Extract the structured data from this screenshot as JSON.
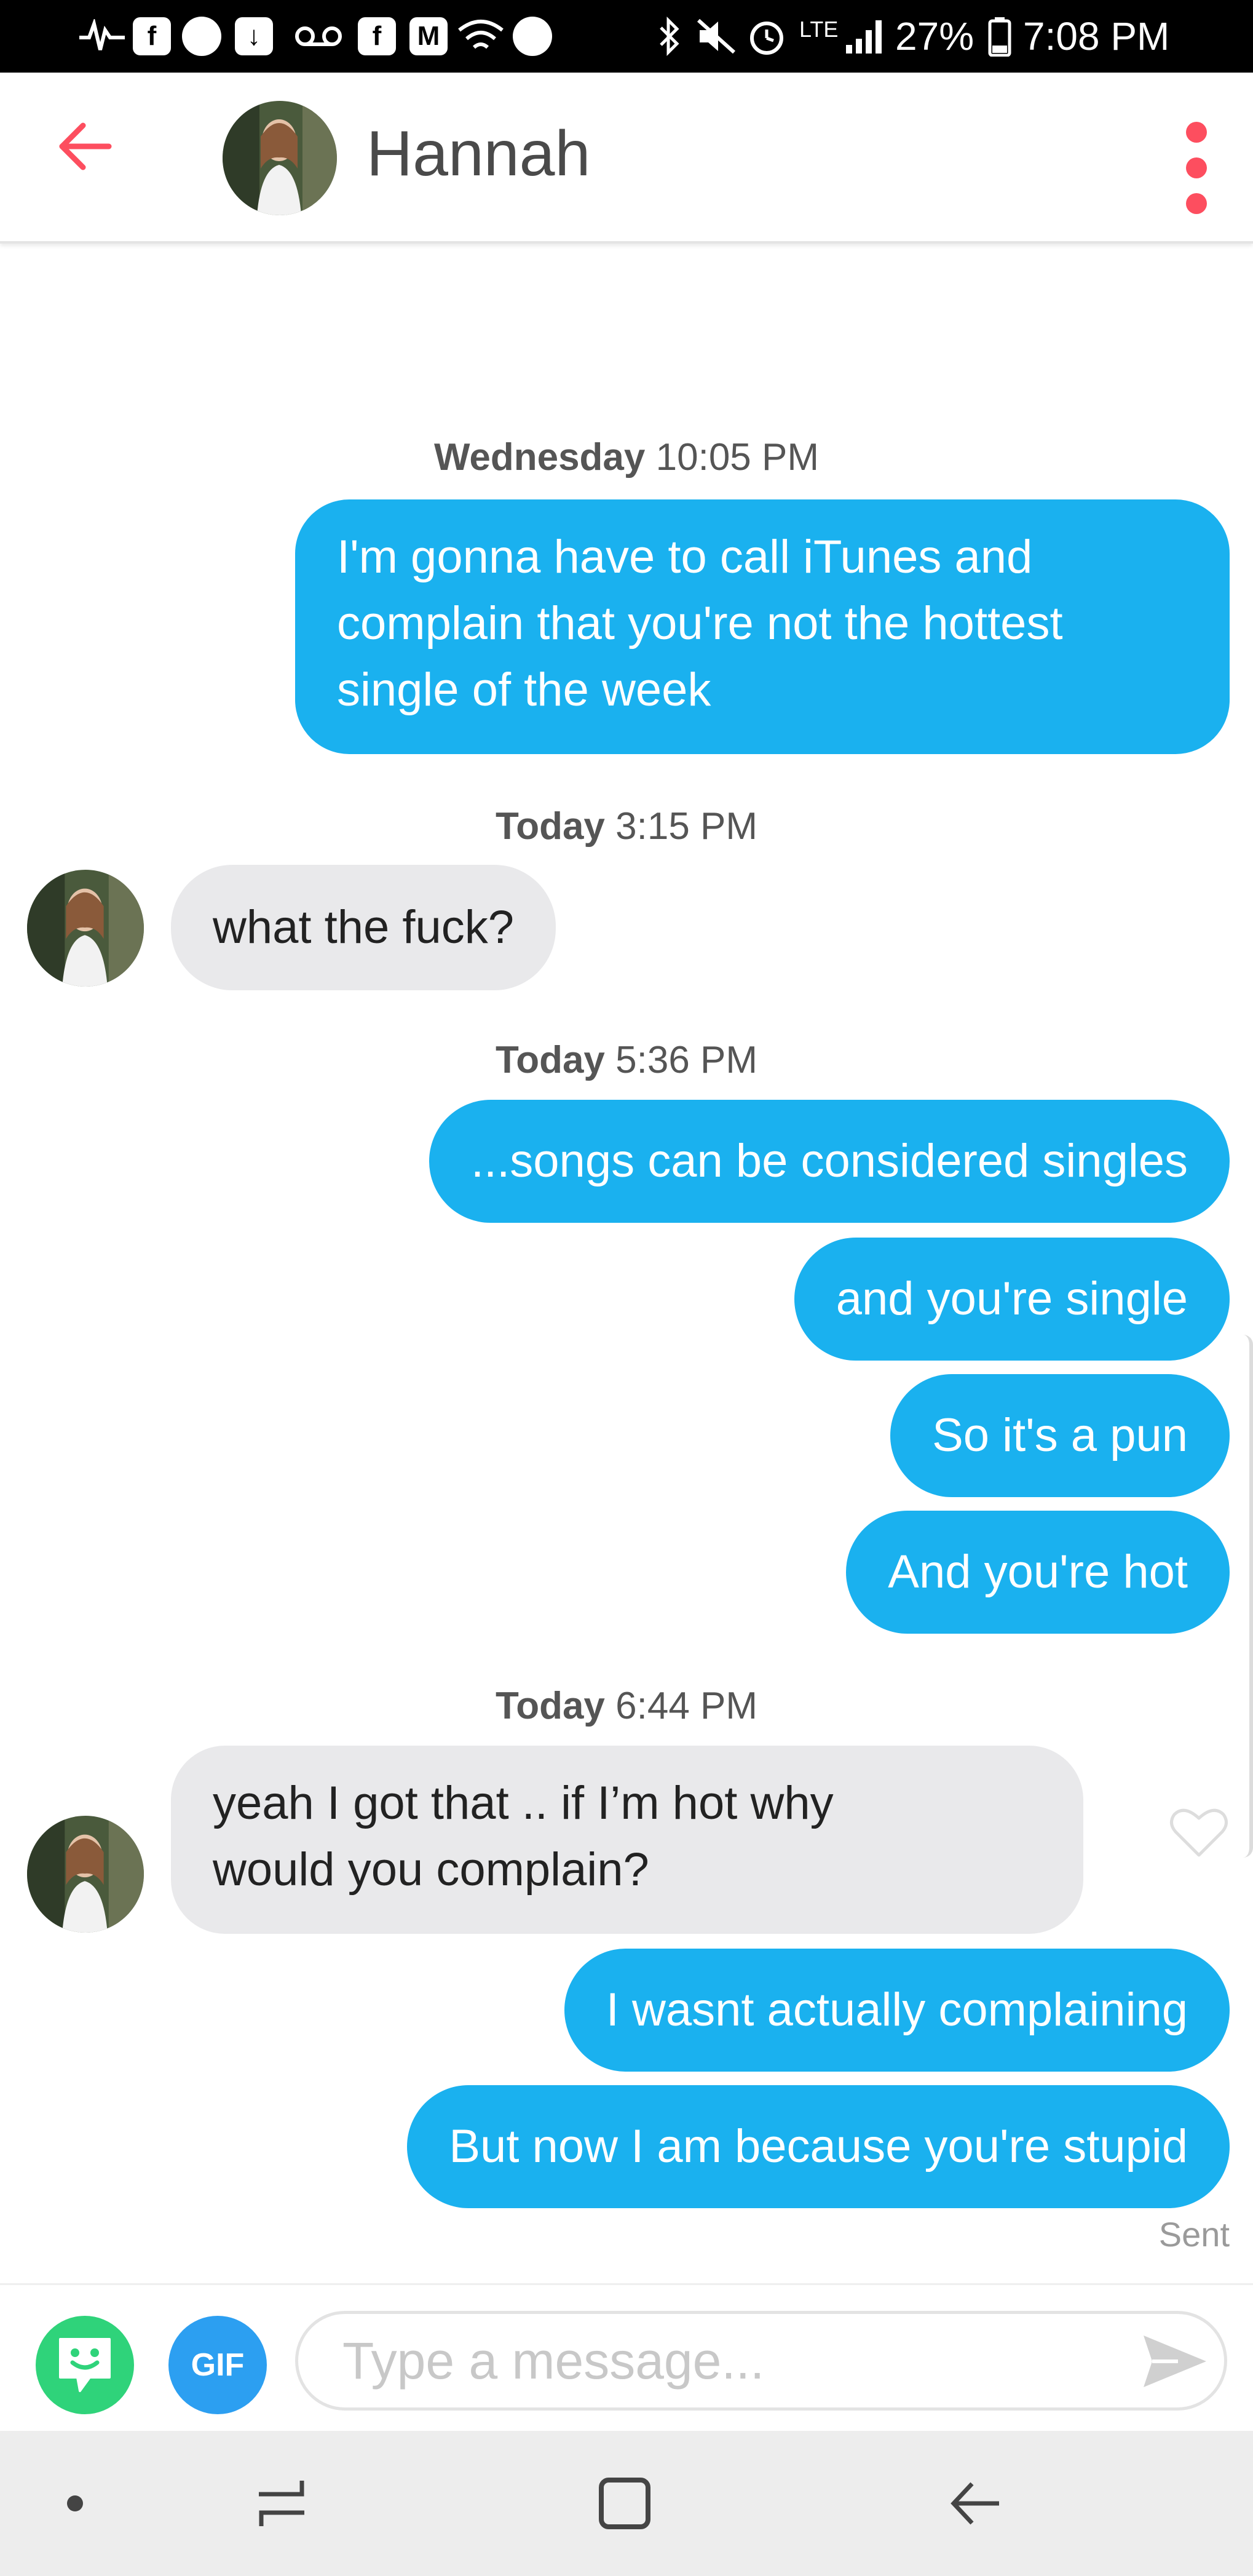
{
  "status_bar": {
    "battery": "27%",
    "time": "7:08 PM",
    "network": "LTE",
    "icons": [
      "activity-icon",
      "facebook-icon",
      "messenger-icon",
      "download-icon",
      "voicemail-icon",
      "facebook-icon",
      "gmail-icon",
      "wifi-icon",
      "sync-icon",
      "bluetooth-icon",
      "mute-icon",
      "alarm-icon",
      "signal-icon",
      "battery-icon"
    ]
  },
  "header": {
    "name": "Hannah",
    "back_icon": "arrow-left-icon",
    "menu_icon": "more-vertical-icon"
  },
  "chat": {
    "groups": [
      {
        "timestamp_day": "Wednesday",
        "timestamp_time": "10:05 PM",
        "messages": [
          {
            "sender": "me",
            "line1": "I'm gonna have to call iTunes and",
            "line2": "complain that you're not the hottest",
            "line3": "single of the week"
          }
        ]
      },
      {
        "timestamp_day": "Today",
        "timestamp_time": "3:15 PM",
        "messages": [
          {
            "sender": "them",
            "text": "what the fuck?"
          }
        ]
      },
      {
        "timestamp_day": "Today",
        "timestamp_time": "5:36 PM",
        "messages": [
          {
            "sender": "me",
            "text": "...songs can be considered singles"
          },
          {
            "sender": "me",
            "text": "and you're single"
          },
          {
            "sender": "me",
            "text": "So it's a pun"
          },
          {
            "sender": "me",
            "text": "And you're hot"
          }
        ]
      },
      {
        "timestamp_day": "Today",
        "timestamp_time": "6:44 PM",
        "messages": [
          {
            "sender": "them",
            "line1": "yeah I got that .. if I’m hot why",
            "line2": "would you complain?"
          },
          {
            "sender": "me",
            "text": "I wasnt actually complaining"
          },
          {
            "sender": "me",
            "text": "But now I am because you're stupid"
          }
        ]
      }
    ],
    "sent_label": "Sent"
  },
  "composer": {
    "placeholder": "Type a message...",
    "gif_label": "GIF",
    "sticker_icon": "sticker-icon",
    "send_icon": "send-icon"
  },
  "navbar": {
    "icons": [
      "dot-icon",
      "recent-apps-icon",
      "home-icon",
      "back-icon"
    ]
  },
  "colors": {
    "accent": "#fd4e5f",
    "outgoing": "#1ab1ef",
    "incoming": "#e9e9eb",
    "gif": "#2c9ff1",
    "sticker": "#2fd37a"
  }
}
